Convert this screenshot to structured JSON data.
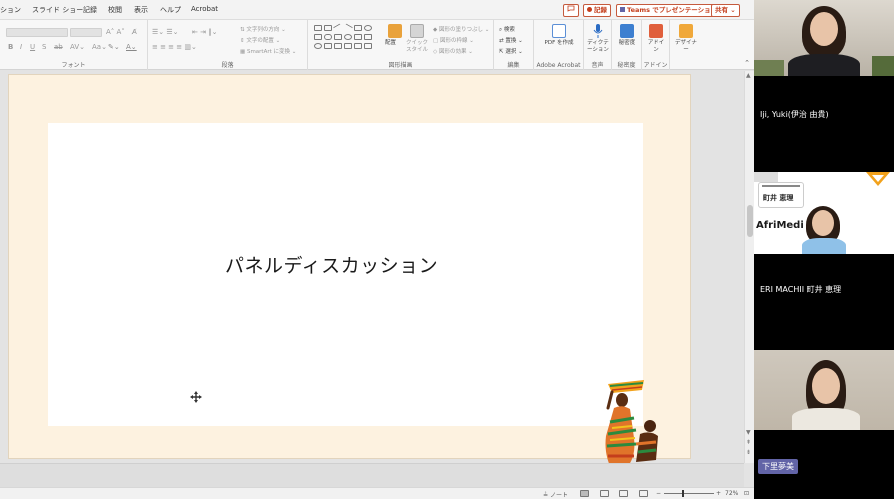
{
  "ribbon": {
    "tabs": [
      "ション",
      "スライド ショー",
      "記録",
      "校閲",
      "表示",
      "ヘルプ",
      "Acrobat"
    ],
    "record_button": "記録",
    "teams_present_button": "Teams でプレゼンテーション",
    "share_button": "共有",
    "groups": {
      "font": "フォント",
      "paragraph": "段落",
      "drawing": "図形描画",
      "editing": "編集",
      "adobe": "Adobe Acrobat",
      "voice": "音声",
      "sensitivity": "秘密度",
      "addins": "アドイン"
    },
    "paragraph_cmds": [
      "文字列の方向",
      "文字の配置",
      "SmartArt に変換"
    ],
    "drawing_cmds": [
      "図形の塗りつぶし",
      "図形の枠線",
      "図形の効果"
    ],
    "arrange_label": "配置",
    "quick_style_label": "クイック スタイル",
    "editing_cmds": [
      "検索",
      "置換",
      "選択"
    ],
    "adobe_btn": "PDF を作成",
    "dictate_btn": "ディクテーション",
    "sensitivity_btn": "秘密度",
    "addin_btn": "アドイン",
    "designer_btn": "デザイナー"
  },
  "slide": {
    "title": "パネルディスカッション"
  },
  "statusbar": {
    "notes": "ノート",
    "zoom": "72%"
  },
  "participants": [
    {
      "name": "",
      "type": "video"
    },
    {
      "name": "Iji, Yuki(伊治 由貴)",
      "type": "label"
    },
    {
      "name": "町井 恵理",
      "type": "video",
      "badge_text": "AfriMedi"
    },
    {
      "name": "ERI MACHII 町井 恵理",
      "type": "label"
    },
    {
      "name": "下里夢美",
      "type": "video"
    }
  ],
  "colors": {
    "ppt_accent": "#c43e1c",
    "slide_frame_bg": "#fdf2e0",
    "teams_chip": "#6264a7"
  }
}
